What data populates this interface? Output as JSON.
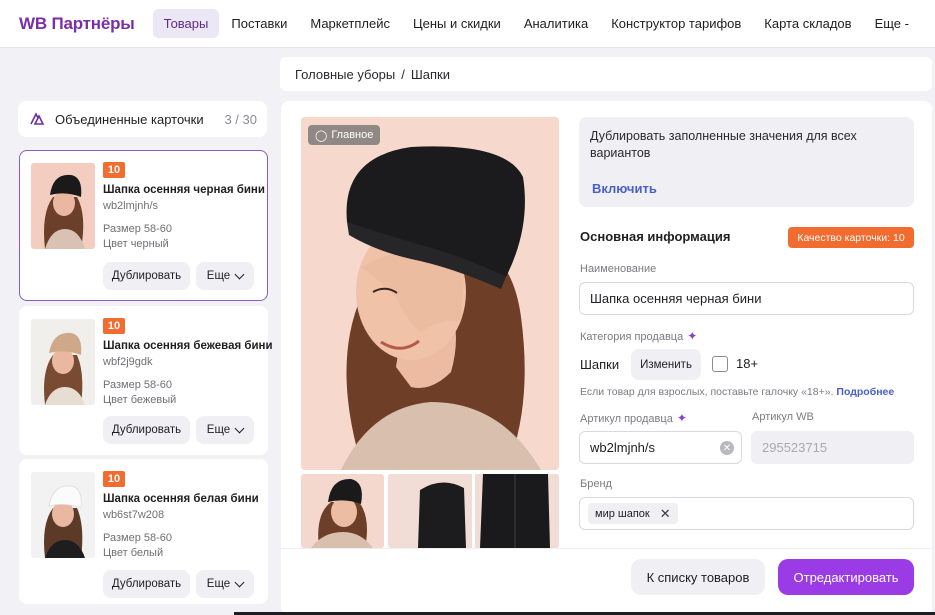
{
  "app": {
    "logo": "WB Партнёры"
  },
  "nav": {
    "items": [
      {
        "label": "Товары",
        "active": true
      },
      {
        "label": "Поставки"
      },
      {
        "label": "Маркетплейс"
      },
      {
        "label": "Цены и скидки"
      },
      {
        "label": "Аналитика"
      },
      {
        "label": "Конструктор тарифов"
      },
      {
        "label": "Карта складов"
      },
      {
        "label": "Еще -"
      }
    ]
  },
  "breadcrumb": {
    "parent": "Головные уборы",
    "separator": "/",
    "current": "Шапки"
  },
  "sidebar": {
    "title": "Объединенные карточки",
    "count": "3 / 30",
    "icon": "merged-cards-icon",
    "cards": [
      {
        "quality": "10",
        "title": "Шапка осенняя черная бини",
        "sku": "wb2lmjnh/s",
        "size": "Размер  58-60",
        "color": "Цвет черный",
        "duplicate_label": "Дублировать",
        "more_label": "Еще",
        "selected": true
      },
      {
        "quality": "10",
        "title": "Шапка осенняя бежевая бини",
        "sku": "wbf2j9gdk",
        "size": "Размер  58-60",
        "color": "Цвет бежевый",
        "duplicate_label": "Дублировать",
        "more_label": "Еще"
      },
      {
        "quality": "10",
        "title": "Шапка осенняя белая бини",
        "sku": "wb6st7w208",
        "size": "Размер  58-60",
        "color": "Цвет белый",
        "duplicate_label": "Дублировать",
        "more_label": "Еще"
      }
    ]
  },
  "photos": {
    "main_badge": "Главное"
  },
  "duplicate_box": {
    "text": "Дублировать заполненные значения для всех вариантов",
    "link": "Включить"
  },
  "info": {
    "section_title": "Основная информация",
    "quality_badge": "Качество карточки: 10",
    "name_label": "Наименование",
    "name_value": "Шапка осенняя черная бини",
    "category_label": "Категория продавца",
    "category_value": "Шапки",
    "change_label": "Изменить",
    "age_label": "18+",
    "hint_text": "Если товар для взрослых, поставьте галочку «18+».",
    "hint_link": "Подробнее",
    "seller_sku_label": "Артикул продавца",
    "seller_sku_value": "wb2lmjnh/s",
    "wb_sku_label": "Артикул WB",
    "wb_sku_value": "295523715",
    "brand_label": "Бренд",
    "brand_chip": "мир шапок"
  },
  "footer": {
    "back_label": "К списку товаров",
    "edit_label": "Отредактировать"
  },
  "colors": {
    "brand": "#7a2ea8",
    "accent": "#9b3be6",
    "badge": "#f26b2f",
    "link": "#4a5fc8"
  }
}
